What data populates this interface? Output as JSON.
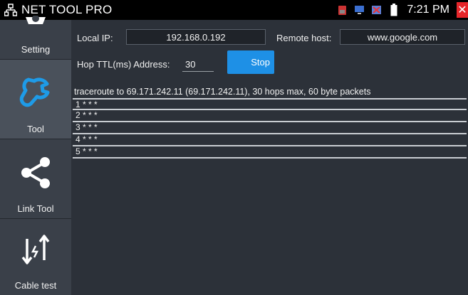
{
  "statusbar": {
    "app_title": "NET TOOL PRO",
    "time": "7:21 PM",
    "icons": [
      "network-icon",
      "sim-icon",
      "monitor-icon",
      "image-icon",
      "battery-icon",
      "close-icon"
    ]
  },
  "sidebar": {
    "items": [
      {
        "label": "Setting",
        "icon": "gear-icon"
      },
      {
        "label": "Tool",
        "icon": "wrench-icon",
        "active": true
      },
      {
        "label": "Link Tool",
        "icon": "share-icon"
      },
      {
        "label": "Cable test",
        "icon": "cable-test-icon"
      }
    ]
  },
  "form": {
    "local_ip_label": "Local IP:",
    "local_ip_value": "192.168.0.192",
    "remote_host_label": "Remote host:",
    "remote_host_value": "www.google.com",
    "hop_label": "Hop TTL(ms) Address:",
    "hop_value": "30",
    "stop_label": "Stop"
  },
  "output": {
    "header": "traceroute to 69.171.242.11 (69.171.242.11), 30 hops max, 60 byte packets",
    "rows": [
      "1 * * *",
      "2 * * *",
      "3 * * *",
      "4 * * *",
      "5 * * *"
    ]
  },
  "colors": {
    "accent": "#1e90e6",
    "close": "#e6262a",
    "background": "#2c3139"
  }
}
